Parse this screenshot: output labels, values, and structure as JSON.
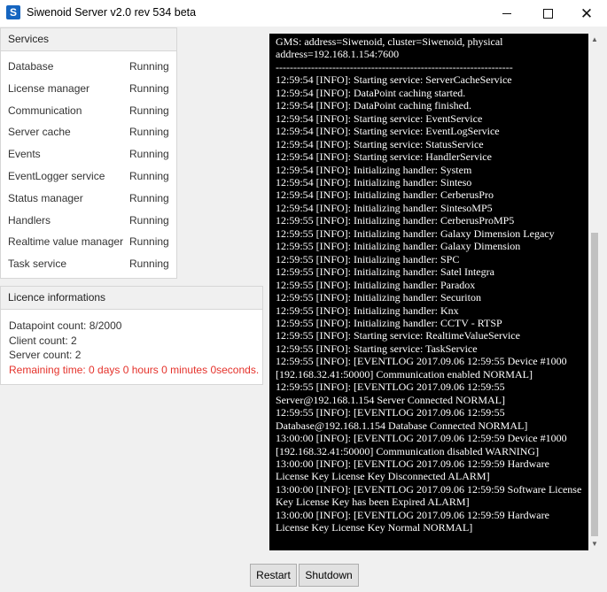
{
  "window": {
    "title": "Siwenoid Server v2.0 rev 534 beta",
    "icon_glyph": "S",
    "minimize": "",
    "close": "✕"
  },
  "services": {
    "header": "Services",
    "items": [
      {
        "name": "Database",
        "status": "Running"
      },
      {
        "name": "License manager",
        "status": "Running"
      },
      {
        "name": "Communication",
        "status": "Running"
      },
      {
        "name": "Server cache",
        "status": "Running"
      },
      {
        "name": "Events",
        "status": "Running"
      },
      {
        "name": "EventLogger service",
        "status": "Running"
      },
      {
        "name": "Status manager",
        "status": "Running"
      },
      {
        "name": "Handlers",
        "status": "Running"
      },
      {
        "name": "Realtime value manager",
        "status": "Running"
      },
      {
        "name": "Task service",
        "status": "Running"
      }
    ]
  },
  "licence": {
    "header": "Licence informations",
    "datapoint_count": "Datapoint count: 8/2000",
    "client_count": "Client count: 2",
    "server_count": "Server count: 2",
    "remaining_time": "Remaining time: 0 days 0 hours 0 minutes 0seconds."
  },
  "log": {
    "text": "GMS: address=Siwenoid, cluster=Siwenoid, physical address=192.168.1.154:7600\n-------------------------------------------------------------------\n12:59:54 [INFO]: Starting service: ServerCacheService\n12:59:54 [INFO]: DataPoint caching started.\n12:59:54 [INFO]: DataPoint caching finished.\n12:59:54 [INFO]: Starting service: EventService\n12:59:54 [INFO]: Starting service: EventLogService\n12:59:54 [INFO]: Starting service: StatusService\n12:59:54 [INFO]: Starting service: HandlerService\n12:59:54 [INFO]: Initializing handler: System\n12:59:54 [INFO]: Initializing handler: Sinteso\n12:59:54 [INFO]: Initializing handler: CerberusPro\n12:59:54 [INFO]: Initializing handler: SintesoMP5\n12:59:55 [INFO]: Initializing handler: CerberusProMP5\n12:59:55 [INFO]: Initializing handler: Galaxy Dimension Legacy\n12:59:55 [INFO]: Initializing handler: Galaxy Dimension\n12:59:55 [INFO]: Initializing handler: SPC\n12:59:55 [INFO]: Initializing handler: Satel Integra\n12:59:55 [INFO]: Initializing handler: Paradox\n12:59:55 [INFO]: Initializing handler: Securiton\n12:59:55 [INFO]: Initializing handler: Knx\n12:59:55 [INFO]: Initializing handler: CCTV - RTSP\n12:59:55 [INFO]: Starting service: RealtimeValueService\n12:59:55 [INFO]: Starting service: TaskService\n12:59:55 [INFO]: [EVENTLOG 2017.09.06 12:59:55 Device #1000 [192.168.32.41:50000] Communication enabled NORMAL]\n12:59:55 [INFO]: [EVENTLOG 2017.09.06 12:59:55 Server@192.168.1.154 Server Connected NORMAL]\n12:59:55 [INFO]: [EVENTLOG 2017.09.06 12:59:55 Database@192.168.1.154 Database Connected NORMAL]\n13:00:00 [INFO]: [EVENTLOG 2017.09.06 12:59:59 Device #1000 [192.168.32.41:50000] Communication disabled WARNING]\n13:00:00 [INFO]: [EVENTLOG 2017.09.06 12:59:59 Hardware License Key License Key Disconnected ALARM]\n13:00:00 [INFO]: [EVENTLOG 2017.09.06 12:59:59 Software License Key License Key has been Expired ALARM]\n13:00:00 [INFO]: [EVENTLOG 2017.09.06 12:59:59 Hardware License Key License Key Normal NORMAL]"
  },
  "buttons": {
    "restart": "Restart",
    "shutdown": "Shutdown"
  },
  "colors": {
    "warning_text": "#e5322b",
    "log_background": "#000000",
    "log_text": "#ffffff"
  }
}
